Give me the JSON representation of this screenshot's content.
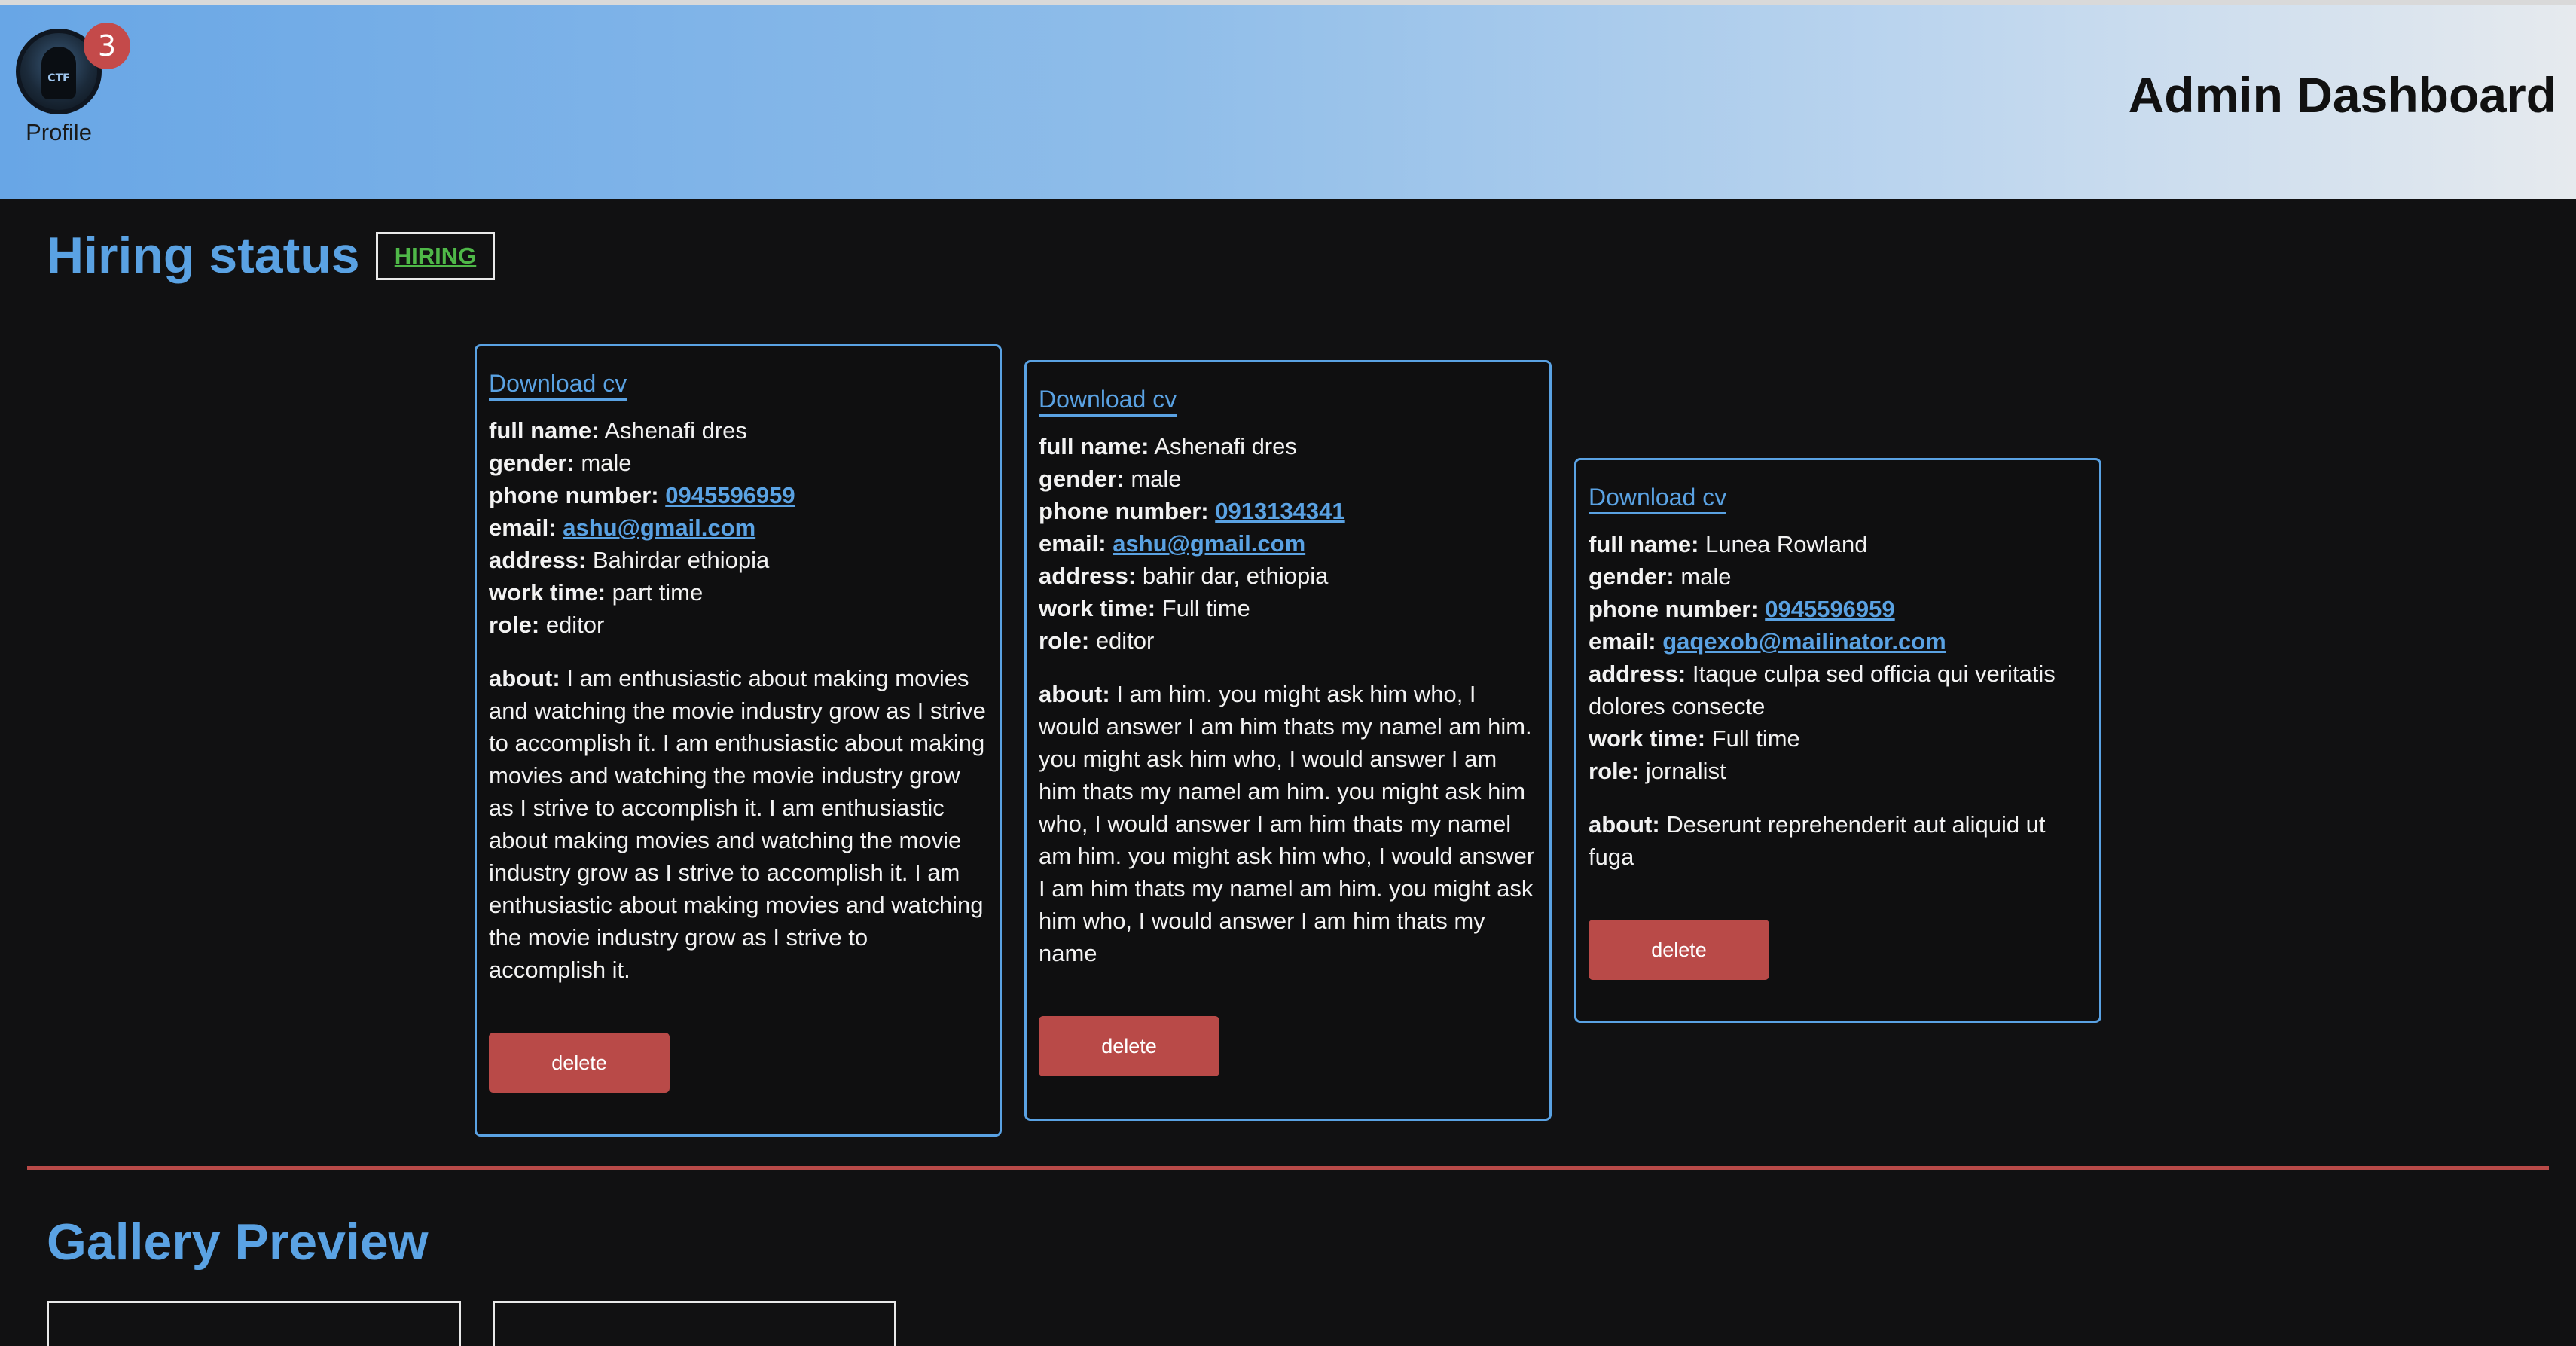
{
  "header": {
    "profile_label": "Profile",
    "notification_count": "3",
    "avatar_text": "CTF",
    "title": "Admin Dashboard"
  },
  "hiring": {
    "title": "Hiring status",
    "status": "HIRING"
  },
  "labels": {
    "download": "Download cv",
    "full_name": "full name:",
    "gender": "gender:",
    "phone": "phone number:",
    "email": "email:",
    "address": "address:",
    "work_time": "work time:",
    "role": "role:",
    "about": "about:",
    "delete": "delete"
  },
  "applicants": [
    {
      "full_name": "Ashenafi dres",
      "gender": "male",
      "phone": "0945596959",
      "email": "ashu@gmail.com",
      "address": "Bahirdar ethiopia",
      "work_time": "part time",
      "role": "editor",
      "about": "I am enthusiastic about making movies and watching the movie industry grow as I strive to accomplish it. I am enthusiastic about making movies and watching the movie industry grow as I strive to accomplish it. I am enthusiastic about making movies and watching the movie industry grow as I strive to accomplish it. I am enthusiastic about making movies and watching the movie industry grow as I strive to accomplish it."
    },
    {
      "full_name": "Ashenafi dres",
      "gender": "male",
      "phone": "0913134341",
      "email": "ashu@gmail.com",
      "address": "bahir dar, ethiopia",
      "work_time": "Full time",
      "role": "editor",
      "about": "I am him. you might ask him who, I would answer I am him thats my namel am him. you might ask him who, I would answer I am him thats my namel am him. you might ask him who, I would answer I am him thats my namel am him. you might ask him who, I would answer I am him thats my namel am him. you might ask him who, I would answer I am him thats my name"
    },
    {
      "full_name": "Lunea Rowland",
      "gender": "male",
      "phone": "0945596959",
      "email": "gaqexob@mailinator.com",
      "address": "Itaque culpa sed officia qui veritatis dolores consecte",
      "work_time": "Full time",
      "role": "jornalist",
      "about": "Deserunt reprehenderit aut aliquid ut fuga"
    }
  ],
  "gallery": {
    "title": "Gallery Preview"
  },
  "colors": {
    "accent": "#5aa2e3",
    "danger": "#b94a48",
    "hiring_green": "#4fb848",
    "background": "#111112"
  }
}
